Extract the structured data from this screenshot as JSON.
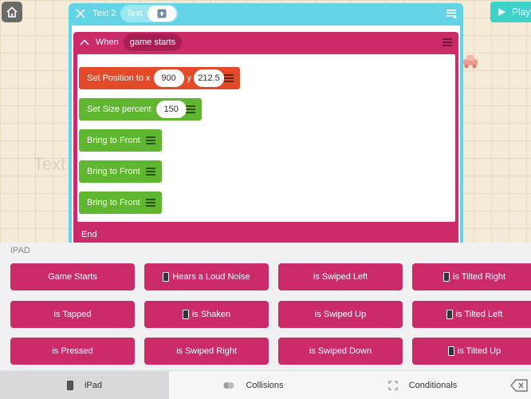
{
  "top": {
    "play_label": "Play",
    "background_text": "Text"
  },
  "script_panel": {
    "object_name": "Text 2",
    "text_chip_label": "Text",
    "rule": {
      "when_label": "When",
      "event": "game starts",
      "end_label": "End",
      "blocks": [
        {
          "type": "set_position",
          "label": "Set Position to x",
          "x": "900",
          "y_label": "y",
          "y": "212.5"
        },
        {
          "type": "set_size",
          "label": "Set Size percent",
          "value": "150"
        },
        {
          "type": "bring_front",
          "label": "Bring to Front"
        },
        {
          "type": "bring_front",
          "label": "Bring to Front"
        },
        {
          "type": "bring_front",
          "label": "Bring to Front"
        }
      ]
    }
  },
  "tray": {
    "title": "IPAD",
    "tiles": [
      [
        "Game Starts",
        "Hears a Loud Noise",
        "is Swiped Left",
        "is Tilted Right"
      ],
      [
        "is Tapped",
        "is Shaken",
        "is Swiped Up",
        "is Tilted Left"
      ],
      [
        "is Pressed",
        "is Swiped Right",
        "is Swiped Down",
        "is Tilted Up"
      ]
    ],
    "tile_has_phone_icon": [
      [
        false,
        true,
        false,
        true
      ],
      [
        false,
        true,
        false,
        true
      ],
      [
        false,
        false,
        false,
        true
      ]
    ]
  },
  "nav": {
    "tabs": [
      "iPad",
      "Collisions",
      "Conditionals"
    ],
    "active": "iPad"
  },
  "colors": {
    "rule_magenta": "#cc2b69",
    "panel_cyan": "#62d4e6",
    "position_red": "#e34a2a",
    "action_green": "#5fb62f",
    "play_teal": "#3ed1c9"
  }
}
